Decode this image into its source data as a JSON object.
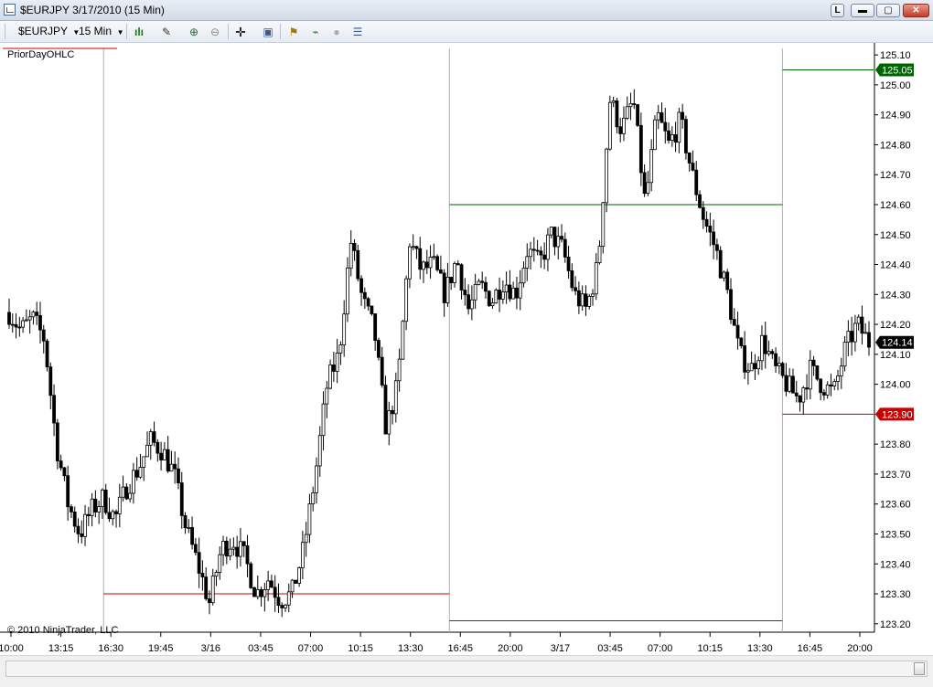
{
  "window": {
    "title": "$EURJPY  3/17/2010 (15 Min)",
    "buttons": {
      "l": "L",
      "min": "▭",
      "max": "▢",
      "close": "✕"
    }
  },
  "toolbar": {
    "instrument": "$EURJPY",
    "interval": "15 Min"
  },
  "chart": {
    "indicator_label": "PriorDayOHLC",
    "copyright": "© 2010 NinjaTrader, LLC",
    "colors": {
      "up_fill": "#ffffff",
      "down_fill": "#000000",
      "high_line": "#006400",
      "low_line": "#c80000",
      "current_tag": "#000000"
    }
  },
  "chart_data": {
    "type": "candlestick",
    "title": "",
    "x_tick_labels": [
      "10:00",
      "13:15",
      "16:30",
      "19:45",
      "3/16",
      "03:45",
      "07:00",
      "10:15",
      "13:30",
      "16:45",
      "20:00",
      "3/17",
      "03:45",
      "07:00",
      "10:15",
      "13:30",
      "16:45",
      "20:00"
    ],
    "y_tick_labels": [
      "125.10",
      "125.00",
      "124.90",
      "124.80",
      "124.70",
      "124.60",
      "124.50",
      "124.40",
      "124.30",
      "124.20",
      "124.10",
      "124.00",
      "123.90",
      "123.80",
      "123.70",
      "123.60",
      "123.50",
      "123.40",
      "123.30",
      "123.20"
    ],
    "ylim": [
      123.175,
      125.14
    ],
    "grid": false,
    "session_separators": [
      "16:30",
      "16:45",
      "16:45"
    ],
    "prior_day_lines": [
      {
        "kind": "low",
        "from": "16:30",
        "to": "16:45",
        "value": 123.3
      },
      {
        "kind": "high",
        "from": "16:45",
        "to": "16:45",
        "value": 124.6
      },
      {
        "kind": "low",
        "from": "16:45",
        "to": "16:45",
        "value": 123.21
      },
      {
        "kind": "high",
        "from": "16:45",
        "to": "end",
        "value": 125.05
      },
      {
        "kind": "low",
        "from": "16:45",
        "to": "end",
        "value": 123.9
      }
    ],
    "price_tags": [
      {
        "label": "125.05",
        "value": 125.05,
        "color": "#006400"
      },
      {
        "label": "124.14",
        "value": 124.14,
        "color": "#000000"
      },
      {
        "label": "123.90",
        "value": 123.9,
        "color": "#c80000"
      }
    ],
    "close_path": [
      124.24,
      124.18,
      124.22,
      124.15,
      123.8,
      123.6,
      123.5,
      123.58,
      123.62,
      123.55,
      123.66,
      123.72,
      123.81,
      123.78,
      123.7,
      123.52,
      123.4,
      123.27,
      123.45,
      123.48,
      123.42,
      123.3,
      123.35,
      123.28,
      123.3,
      123.45,
      123.7,
      124.0,
      124.1,
      124.48,
      124.28,
      124.18,
      123.85,
      124.0,
      124.48,
      124.38,
      124.4,
      124.3,
      124.42,
      124.25,
      124.33,
      124.28,
      124.35,
      124.3,
      124.45,
      124.4,
      124.5,
      124.45,
      124.3,
      124.25,
      124.4,
      124.95,
      124.85,
      124.95,
      124.6,
      124.9,
      124.8,
      124.88,
      124.7,
      124.55,
      124.45,
      124.3,
      124.1,
      124.05,
      124.15,
      124.05,
      124.0,
      123.95,
      124.05,
      124.0,
      123.97,
      124.12,
      124.2,
      124.14
    ],
    "bars": 250
  }
}
